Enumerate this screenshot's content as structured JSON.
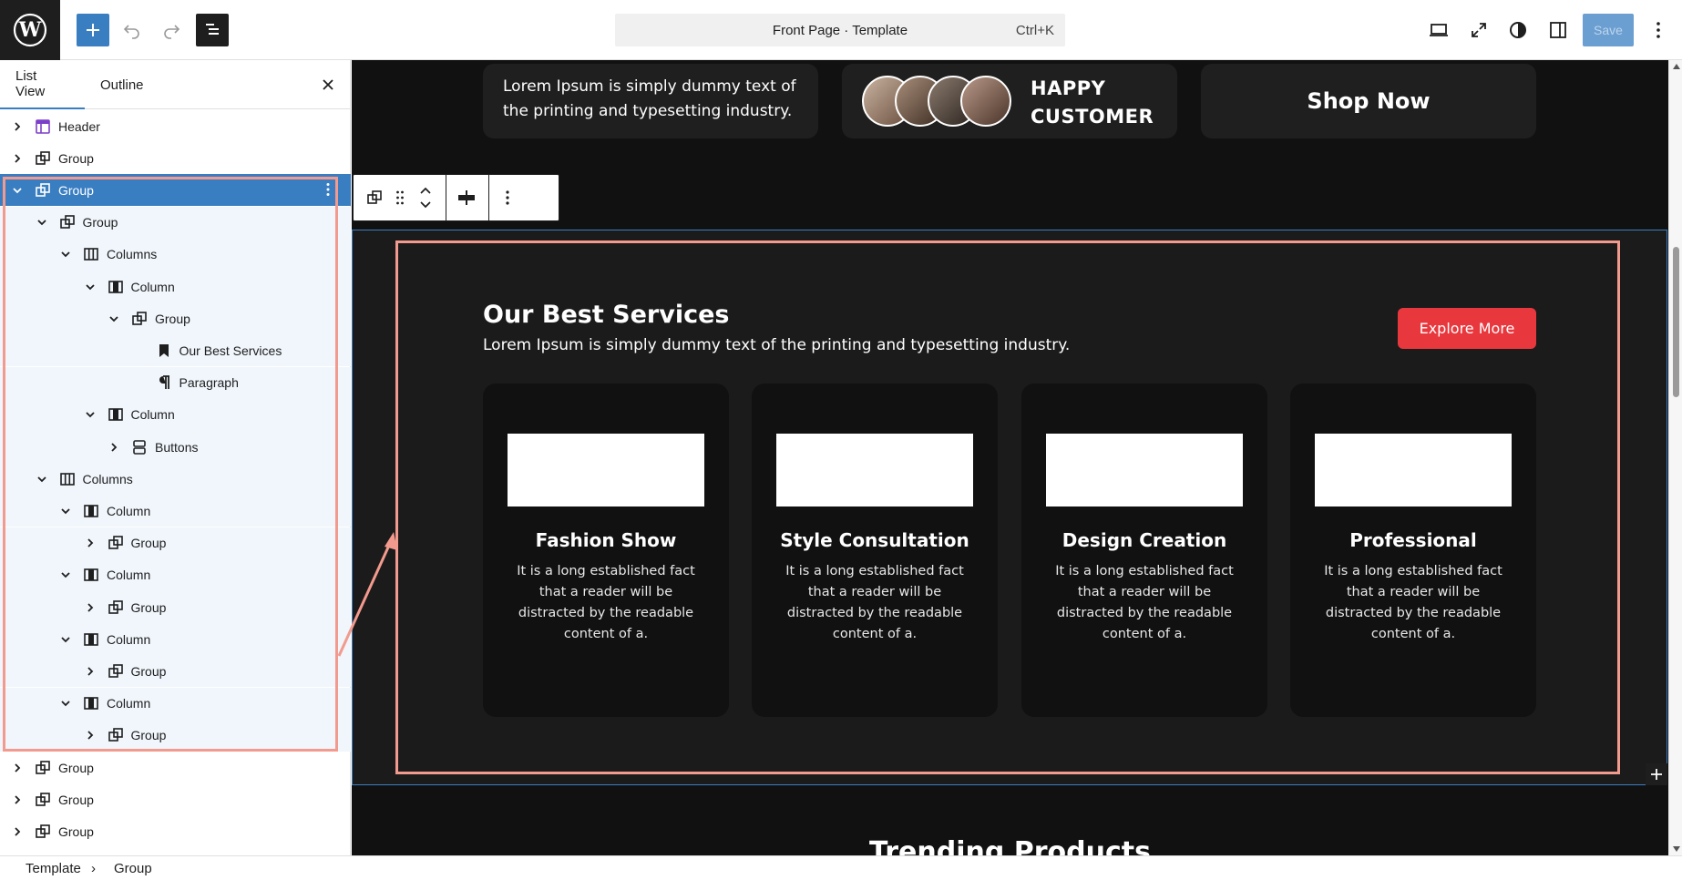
{
  "toolbar": {
    "command_title": "Front Page · Template",
    "command_shortcut": "Ctrl+K",
    "save_label": "Save"
  },
  "sidebar": {
    "tab_list": "List View",
    "tab_outline": "Outline",
    "close_glyph": "✕",
    "rows": [
      {
        "label": "Header",
        "icon": "template-part-icon",
        "depth": 0,
        "expanded": false
      },
      {
        "label": "Group",
        "icon": "group-icon",
        "depth": 0,
        "expanded": false
      },
      {
        "label": "Group",
        "icon": "group-icon",
        "depth": 0,
        "expanded": true,
        "selected": true
      },
      {
        "label": "Group",
        "icon": "group-icon",
        "depth": 1,
        "expanded": true
      },
      {
        "label": "Columns",
        "icon": "columns-icon",
        "depth": 2,
        "expanded": true
      },
      {
        "label": "Column",
        "icon": "column-icon",
        "depth": 3,
        "expanded": true
      },
      {
        "label": "Group",
        "icon": "group-icon",
        "depth": 4,
        "expanded": true
      },
      {
        "label": "Our Best Services",
        "icon": "heading-icon",
        "depth": 5,
        "leaf": true
      },
      {
        "label": "Paragraph",
        "icon": "paragraph-icon",
        "depth": 5,
        "leaf": true
      },
      {
        "label": "Column",
        "icon": "column-icon",
        "depth": 3,
        "expanded": true
      },
      {
        "label": "Buttons",
        "icon": "buttons-icon",
        "depth": 4,
        "expanded": false
      },
      {
        "label": "Columns",
        "icon": "columns-icon",
        "depth": 1,
        "expanded": true
      },
      {
        "label": "Column",
        "icon": "column-icon",
        "depth": 2,
        "expanded": true
      },
      {
        "label": "Group",
        "icon": "group-icon",
        "depth": 3,
        "expanded": false
      },
      {
        "label": "Column",
        "icon": "column-icon",
        "depth": 2,
        "expanded": true
      },
      {
        "label": "Group",
        "icon": "group-icon",
        "depth": 3,
        "expanded": false
      },
      {
        "label": "Column",
        "icon": "column-icon",
        "depth": 2,
        "expanded": true
      },
      {
        "label": "Group",
        "icon": "group-icon",
        "depth": 3,
        "expanded": false
      },
      {
        "label": "Column",
        "icon": "column-icon",
        "depth": 2,
        "expanded": true
      },
      {
        "label": "Group",
        "icon": "group-icon",
        "depth": 3,
        "expanded": false
      },
      {
        "label": "Group",
        "icon": "group-icon",
        "depth": 0,
        "expanded": false
      },
      {
        "label": "Group",
        "icon": "group-icon",
        "depth": 0,
        "expanded": false
      },
      {
        "label": "Group",
        "icon": "group-icon",
        "depth": 0,
        "expanded": false
      }
    ]
  },
  "breadcrumb": {
    "item1": "Template",
    "sep": "›",
    "item2": "Group"
  },
  "canvas": {
    "top_card_text": "Lorem Ipsum is simply dummy text of the printing and typesetting industry.",
    "happy_line1": "HAPPY",
    "happy_line2": "CUSTOMER",
    "shop_now": "Shop Now",
    "services_title": "Our Best Services",
    "services_desc": "Lorem Ipsum is simply dummy text of the printing and typesetting industry.",
    "explore_label": "Explore More",
    "cards": [
      {
        "title": "Fashion Show",
        "text": "It is a long established fact that a reader will be distracted by the readable content of a."
      },
      {
        "title": "Style Consultation",
        "text": "It is a long established fact that a reader will be distracted by the readable content of a."
      },
      {
        "title": "Design Creation",
        "text": "It is a long established fact that a reader will be distracted by the readable content of a."
      },
      {
        "title": "Professional",
        "text": "It is a long established fact that a reader will be distracted by the readable content of a."
      }
    ],
    "trending_title": "Trending Products"
  },
  "colors": {
    "accent": "#3a7ec2",
    "explore_red": "#e8383d",
    "highlight": "#f39a8e",
    "canvas_bg": "#111111"
  }
}
